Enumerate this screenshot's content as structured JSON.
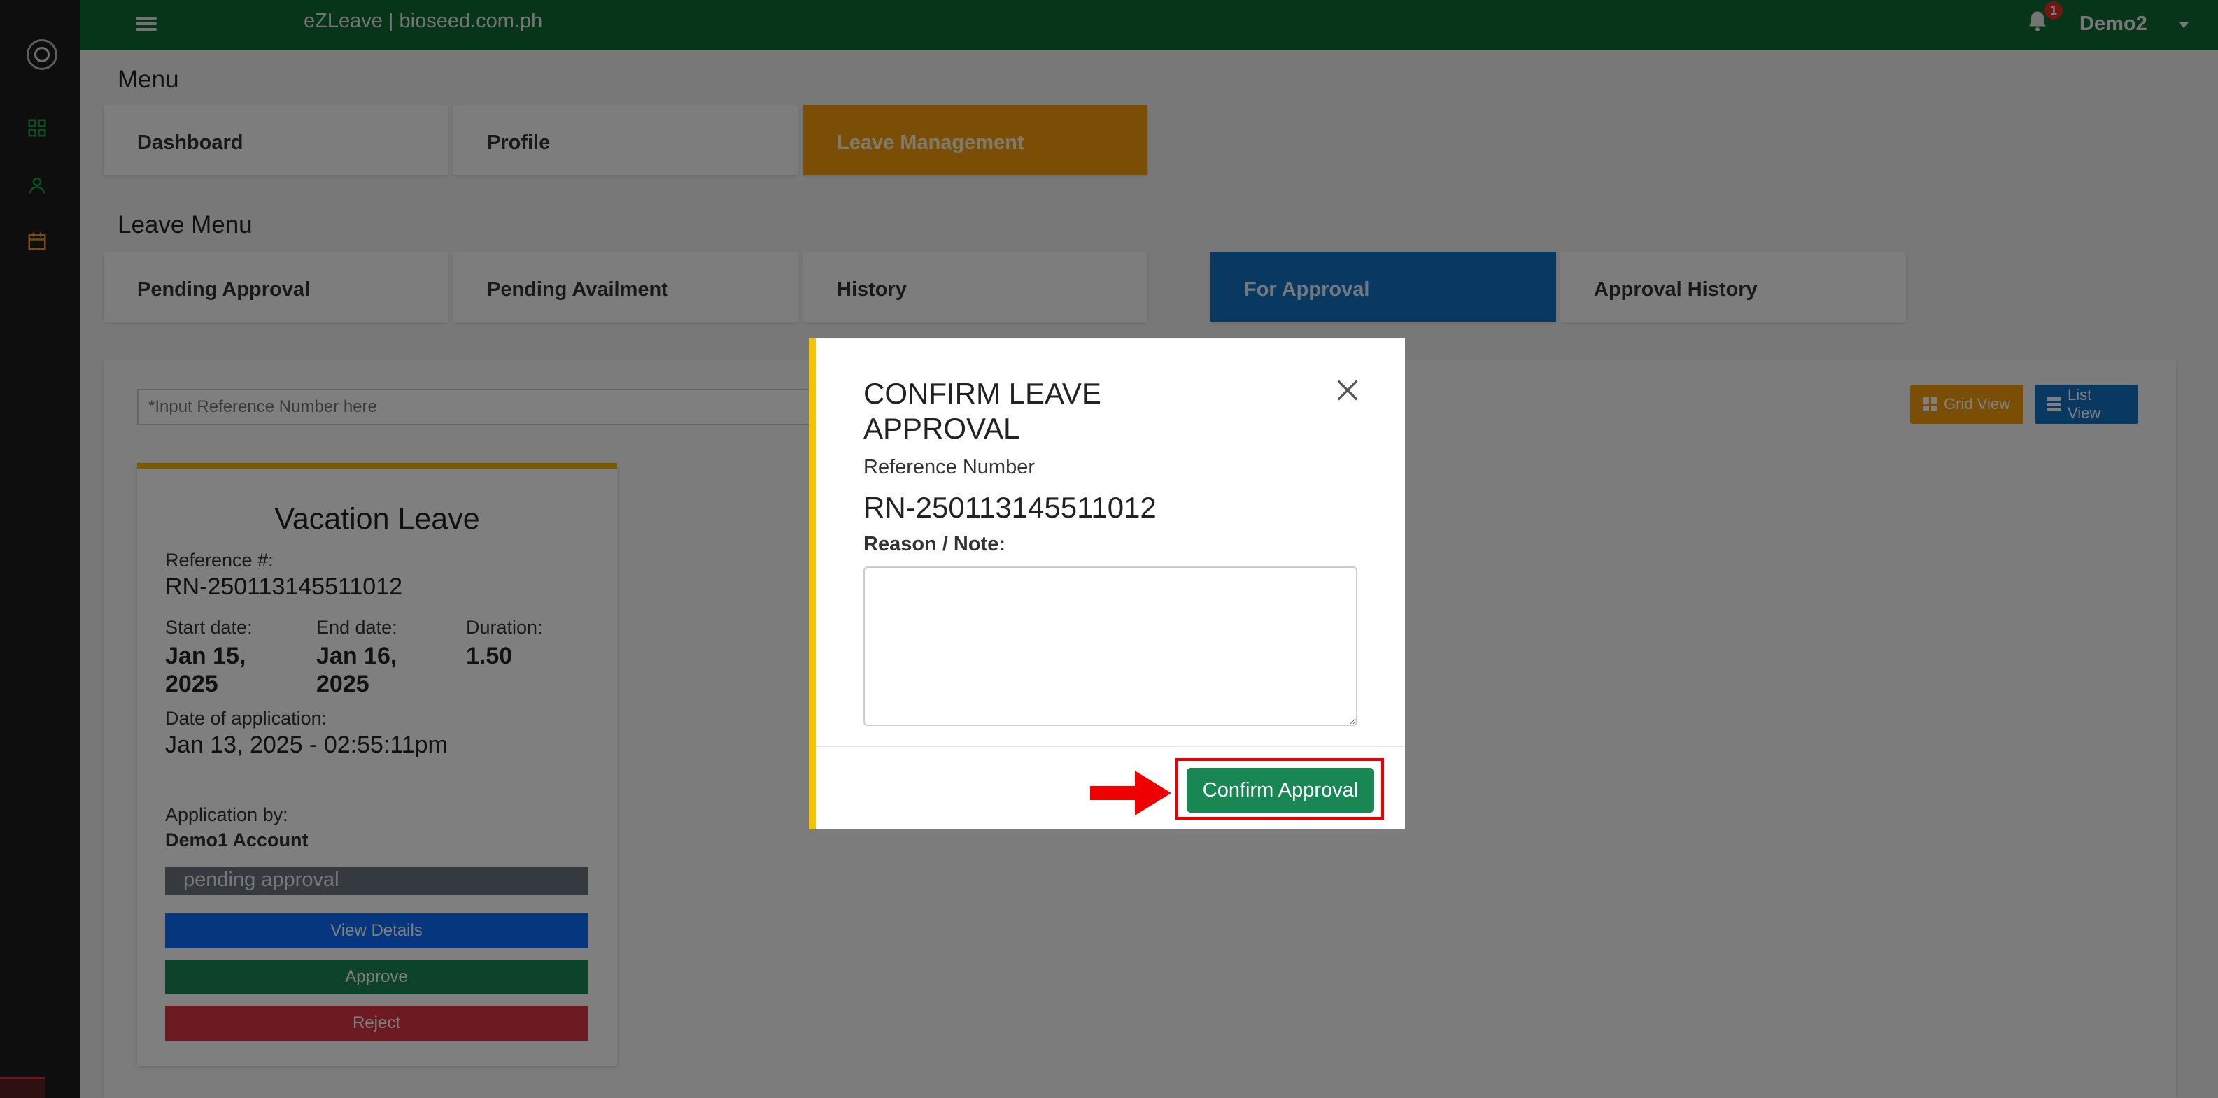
{
  "header": {
    "app_title": "eZLeave | bioseed.com.ph",
    "notification_count": "1",
    "user_name": "Demo2"
  },
  "sidebar": {
    "icons": [
      "logo-icon",
      "dashboard-icon",
      "user-icon",
      "calendar-icon"
    ]
  },
  "menu": {
    "title": "Menu",
    "items": [
      {
        "label": "Dashboard"
      },
      {
        "label": "Profile"
      },
      {
        "label": "Leave Management",
        "active": true
      }
    ]
  },
  "leave_menu": {
    "title": "Leave Menu",
    "items": [
      {
        "label": "Pending Approval"
      },
      {
        "label": "Pending Availment"
      },
      {
        "label": "History"
      },
      {
        "label": "For Approval",
        "active": true
      },
      {
        "label": "Approval History"
      }
    ]
  },
  "search": {
    "placeholder": "*Input Reference Number here"
  },
  "view_toggle": {
    "grid_label": "Grid View",
    "list_label": "List View"
  },
  "leave_card": {
    "type": "Vacation Leave",
    "reference_label": "Reference #:",
    "reference": "RN-250113145511012",
    "start_label": "Start date:",
    "start_date": "Jan 15, 2025",
    "end_label": "End date:",
    "end_date": "Jan 16, 2025",
    "duration_label": "Duration:",
    "duration": "1.50",
    "application_date_label": "Date of application:",
    "application_date": "Jan 13, 2025 - 02:55:11pm",
    "applicant_label": "Application by:",
    "applicant": "Demo1 Account",
    "status": "pending approval",
    "view_details_label": "View Details",
    "approve_label": "Approve",
    "reject_label": "Reject"
  },
  "modal": {
    "title": "CONFIRM LEAVE APPROVAL",
    "reference_label": "Reference Number",
    "reference": "RN-250113145511012",
    "note_label": "Reason / Note:",
    "note_value": "",
    "confirm_label": "Confirm Approval"
  },
  "colors": {
    "topbar": "#0f6b34",
    "accent_orange": "#f59e0b",
    "accent_blue": "#1273c3",
    "confirm_green": "#198754",
    "reject_red": "#dc3545",
    "modal_border": "#f5c400"
  }
}
